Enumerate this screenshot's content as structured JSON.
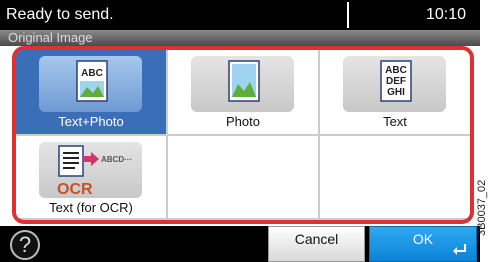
{
  "status": {
    "message": "Ready to send.",
    "time": "10:10"
  },
  "screen": {
    "title": "Original Image"
  },
  "options": [
    {
      "label": "Text+Photo",
      "icon_text": "ABC",
      "icon": "text-photo-icon",
      "selected": true
    },
    {
      "label": "Photo",
      "icon": "photo-icon",
      "selected": false
    },
    {
      "label": "Text",
      "icon_lines": [
        "ABC",
        "DEF",
        "GHI"
      ],
      "icon": "text-icon",
      "selected": false
    },
    {
      "label": "Text (for OCR)",
      "icon_text": "ABCD···",
      "icon_badge": "OCR",
      "icon": "ocr-icon",
      "selected": false
    }
  ],
  "footer": {
    "help_label": "?",
    "cancel_label": "Cancel",
    "ok_label": "OK"
  },
  "doc_code": "3B0037_02",
  "colors": {
    "selected": "#3a6fb8",
    "frame": "#e03030",
    "ok": "#1a95e6"
  }
}
